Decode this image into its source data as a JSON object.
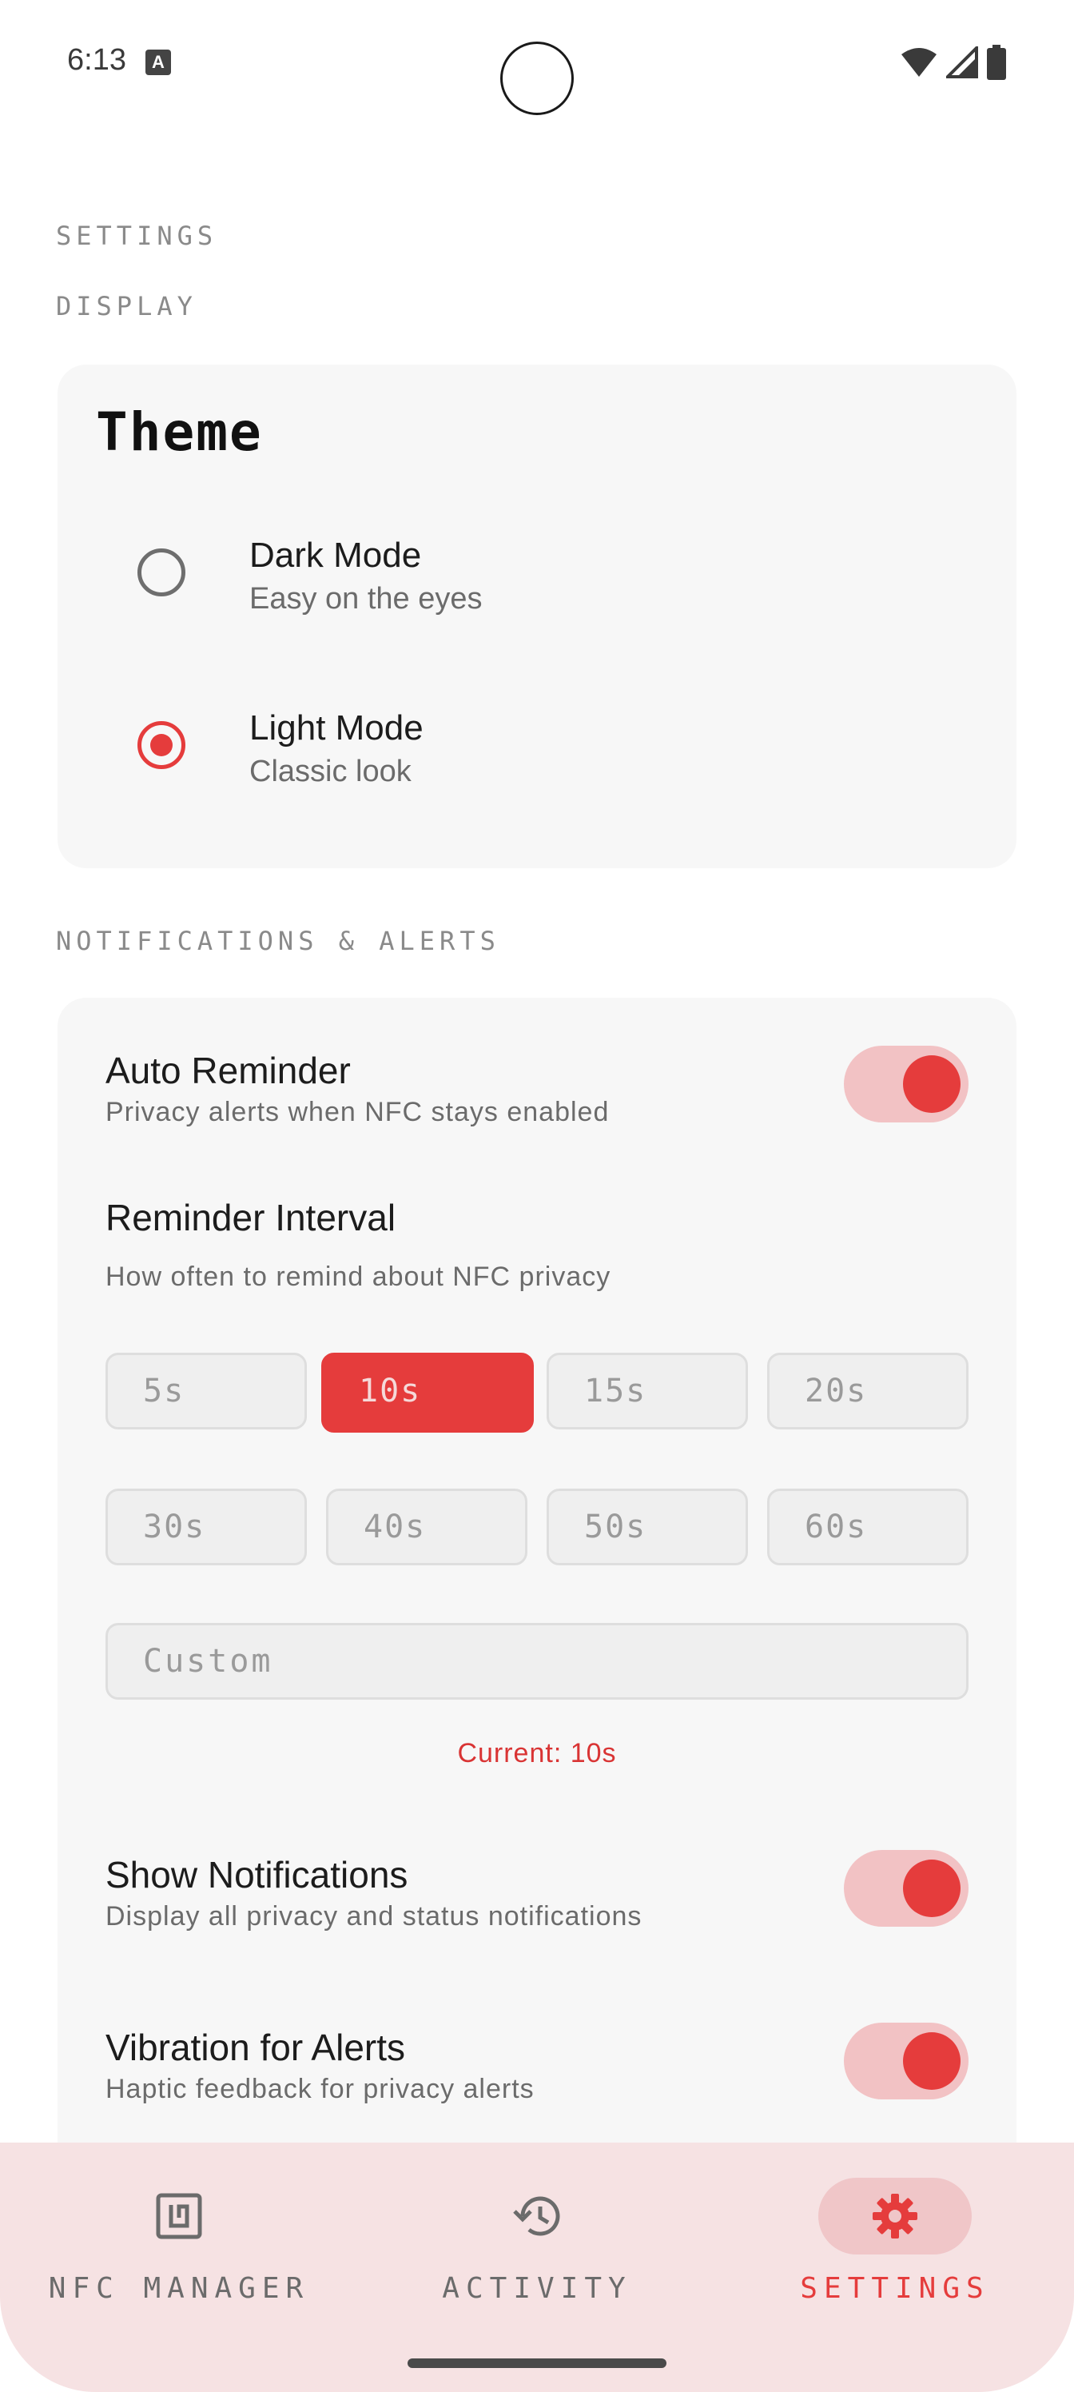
{
  "status_bar": {
    "time": "6:13",
    "notif_icon": "A"
  },
  "page": {
    "title": "SETTINGS"
  },
  "display": {
    "section_label": "DISPLAY",
    "theme_title": "Theme",
    "options": [
      {
        "title": "Dark Mode",
        "subtitle": "Easy on the eyes",
        "selected": false
      },
      {
        "title": "Light Mode",
        "subtitle": "Classic look",
        "selected": true
      }
    ]
  },
  "notifications": {
    "section_label": "NOTIFICATIONS & ALERTS",
    "auto_reminder": {
      "title": "Auto Reminder",
      "subtitle": "Privacy alerts when NFC stays enabled",
      "enabled": true
    },
    "reminder_interval": {
      "title": "Reminder Interval",
      "subtitle": "How often to remind about NFC privacy",
      "options": [
        "5s",
        "10s",
        "15s",
        "20s",
        "30s",
        "40s",
        "50s",
        "60s"
      ],
      "selected": "10s",
      "custom_placeholder": "Custom",
      "current_text": "Current: 10s"
    },
    "show_notifications": {
      "title": "Show Notifications",
      "subtitle": "Display all privacy and status notifications",
      "enabled": true
    },
    "vibration": {
      "title": "Vibration for Alerts",
      "subtitle": "Haptic feedback for privacy alerts",
      "enabled": true
    }
  },
  "bottom_nav": {
    "items": [
      {
        "label": "NFC MANAGER",
        "icon": "nfc-icon",
        "active": false
      },
      {
        "label": "ACTIVITY",
        "icon": "history-icon",
        "active": false
      },
      {
        "label": "SETTINGS",
        "icon": "gear-icon",
        "active": true
      }
    ]
  },
  "colors": {
    "accent": "#e53c3c",
    "toggle_track": "#f2c2c4",
    "nav_bg": "#f6e2e3",
    "card_bg": "#f7f7f7"
  }
}
